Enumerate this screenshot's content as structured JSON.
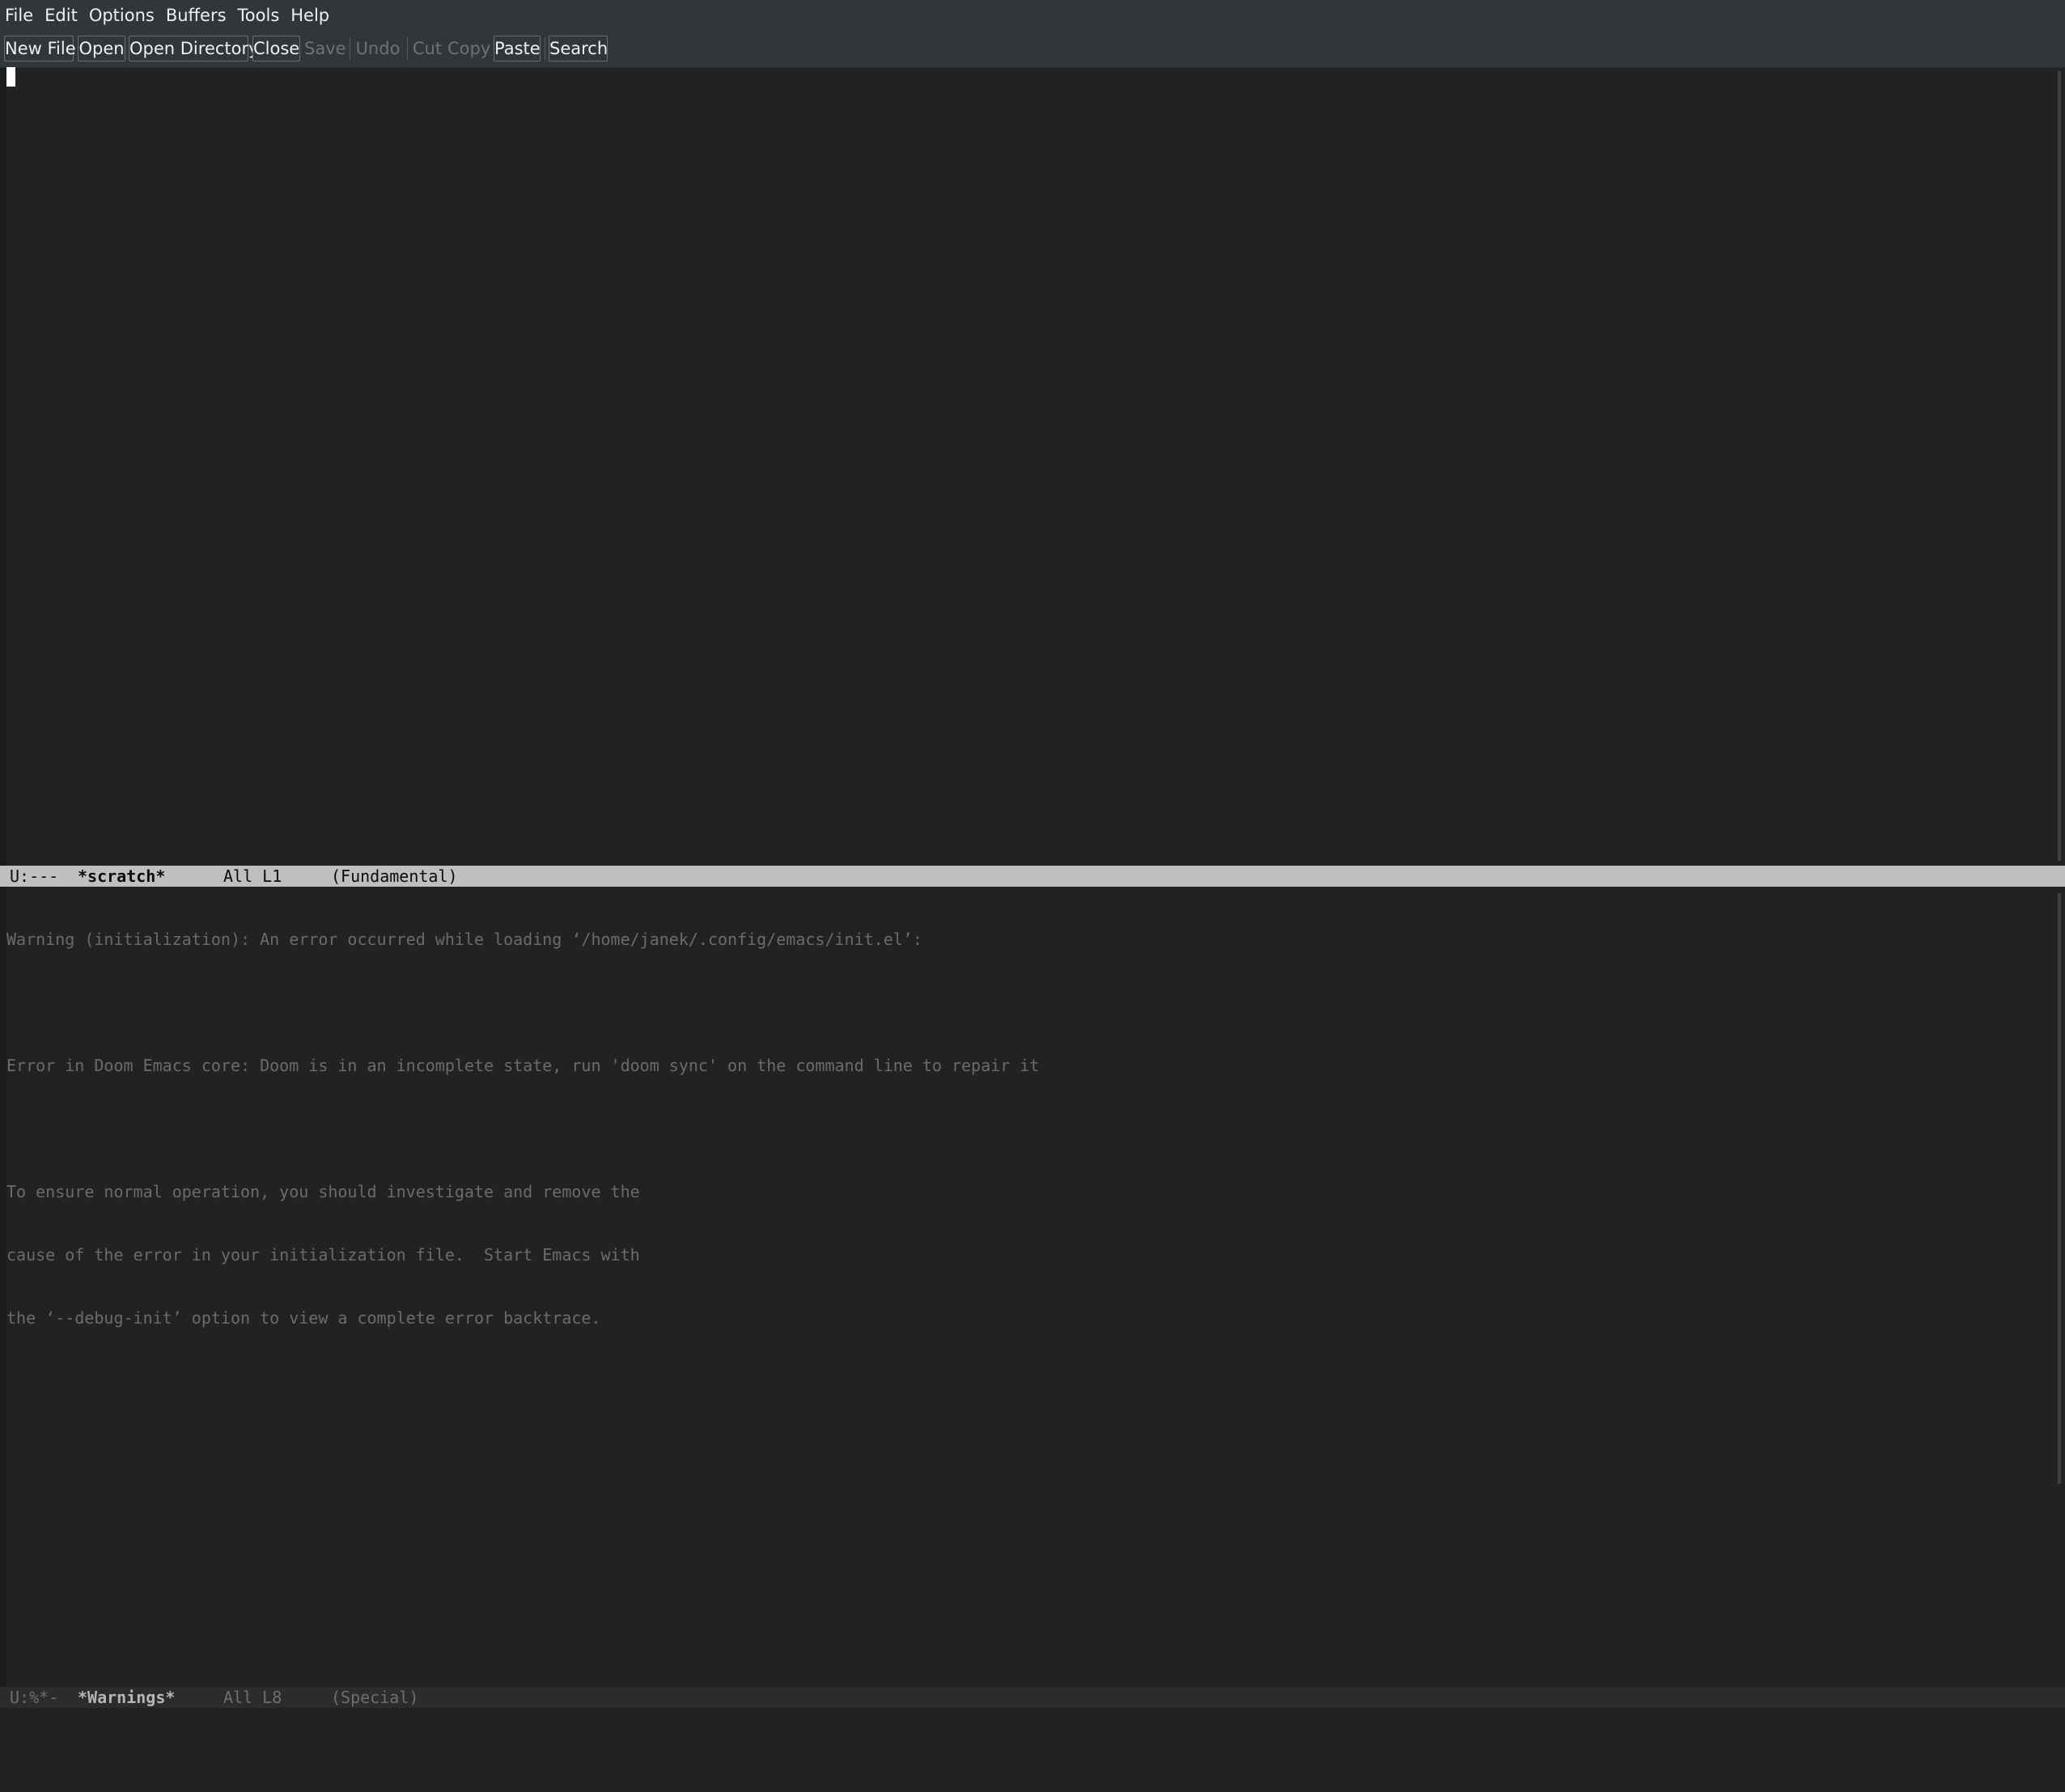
{
  "menubar": {
    "items": [
      "File",
      "Edit",
      "Options",
      "Buffers",
      "Tools",
      "Help"
    ]
  },
  "toolbar": {
    "buttons": [
      {
        "label": "New File",
        "enabled": true
      },
      {
        "label": "Open",
        "enabled": true
      },
      {
        "label": "Open Directory",
        "enabled": true
      },
      {
        "label": "Close",
        "enabled": true
      },
      {
        "label": "Save",
        "enabled": false
      },
      {
        "label": "Undo",
        "enabled": false
      },
      {
        "label": "Cut",
        "enabled": false
      },
      {
        "label": "Copy",
        "enabled": false
      },
      {
        "label": "Paste",
        "enabled": true
      },
      {
        "label": "Search",
        "enabled": true
      }
    ]
  },
  "top_window": {
    "modeline": {
      "status": "U:---",
      "buffer": "*scratch*",
      "position": "All L1",
      "mode": "(Fundamental)"
    }
  },
  "bottom_window": {
    "lines": [
      "Warning (initialization): An error occurred while loading ‘/home/janek/.config/emacs/init.el’:",
      "",
      "Error in Doom Emacs core: Doom is in an incomplete state, run 'doom sync' on the command line to repair it",
      "",
      "To ensure normal operation, you should investigate and remove the",
      "cause of the error in your initialization file.  Start Emacs with",
      "the ‘--debug-init’ option to view a complete error backtrace."
    ],
    "modeline": {
      "status": "U:%*-",
      "buffer": "*Warnings*",
      "position": "All L8",
      "mode": "(Special)"
    }
  },
  "colors": {
    "background": "#222222",
    "chrome": "#31363b",
    "active_modeline": "#bfbfbf",
    "inactive_modeline": "#2c2c2c"
  }
}
